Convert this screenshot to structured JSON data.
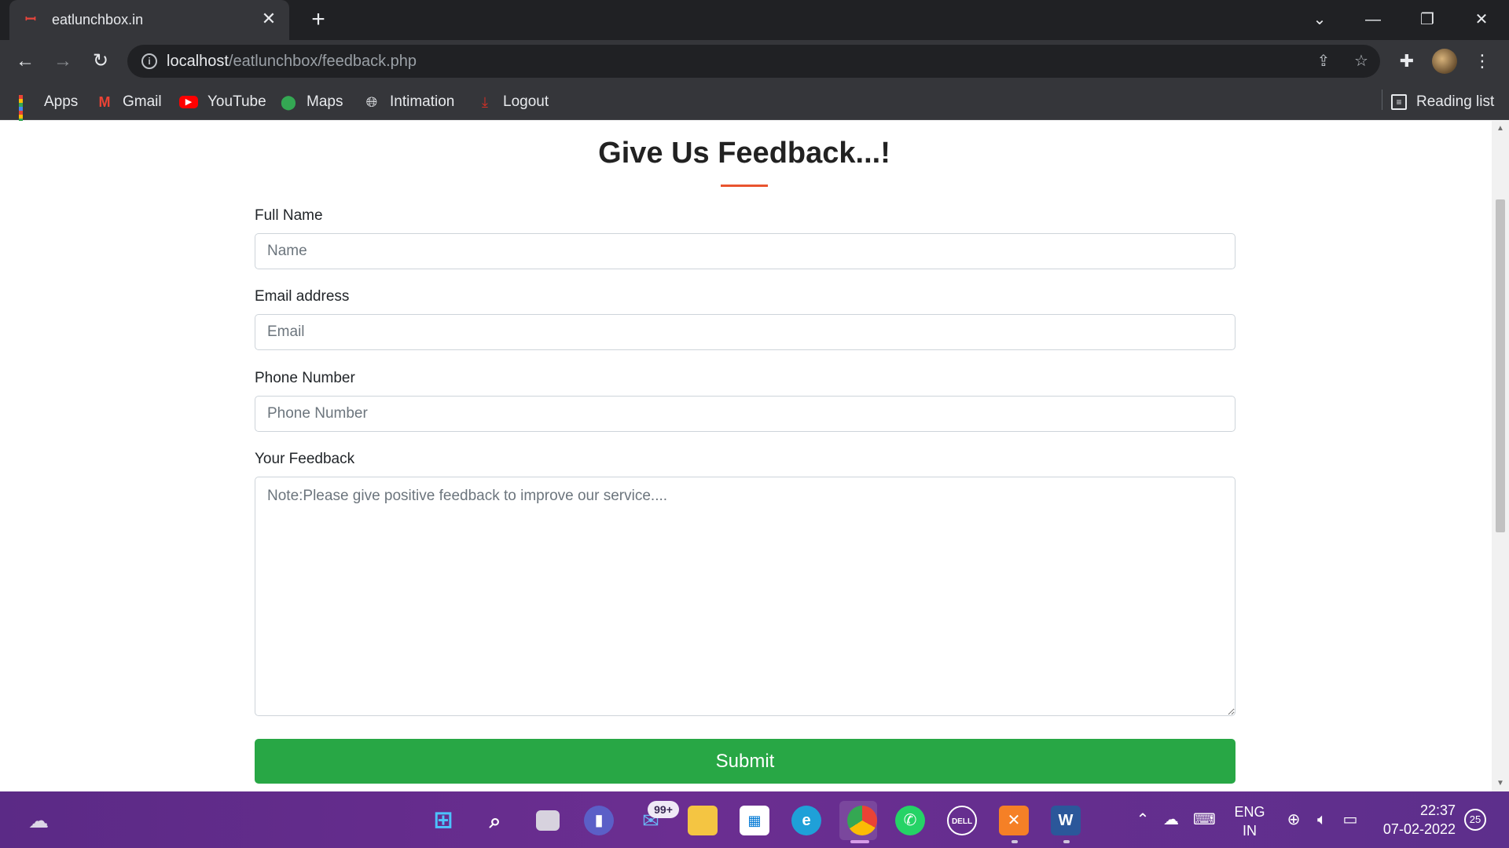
{
  "browser": {
    "tab_title": "eatlunchbox.in",
    "tab_favicon": "fork-spoon-icon",
    "tab_close": "✕",
    "new_tab": "+",
    "url_host": "localhost",
    "url_path": "/eatlunchbox/feedback.php"
  },
  "bookmarks": {
    "items": [
      {
        "label": "Apps",
        "icon": "apps-grid-icon"
      },
      {
        "label": "Gmail",
        "icon": "gmail-icon"
      },
      {
        "label": "YouTube",
        "icon": "youtube-icon"
      },
      {
        "label": "Maps",
        "icon": "maps-icon"
      },
      {
        "label": "Intimation",
        "icon": "globe-icon"
      },
      {
        "label": "Logout",
        "icon": "logout-icon"
      }
    ],
    "reading_list": "Reading list"
  },
  "page": {
    "heading": "Give Us Feedback...!",
    "accent_color": "#e9542e",
    "fields": {
      "name_label": "Full Name",
      "name_placeholder": "Name",
      "email_label": "Email address",
      "email_placeholder": "Email",
      "phone_label": "Phone Number",
      "phone_placeholder": "Phone Number",
      "feedback_label": "Your Feedback",
      "feedback_placeholder": "Note:Please give positive feedback to improve our service...."
    },
    "submit_label": "Submit",
    "submit_color": "#28a745"
  },
  "taskbar": {
    "mail_badge": "99+",
    "lang_line1": "ENG",
    "lang_line2": "IN",
    "time": "22:37",
    "date": "07-02-2022",
    "notification_count": "25"
  }
}
